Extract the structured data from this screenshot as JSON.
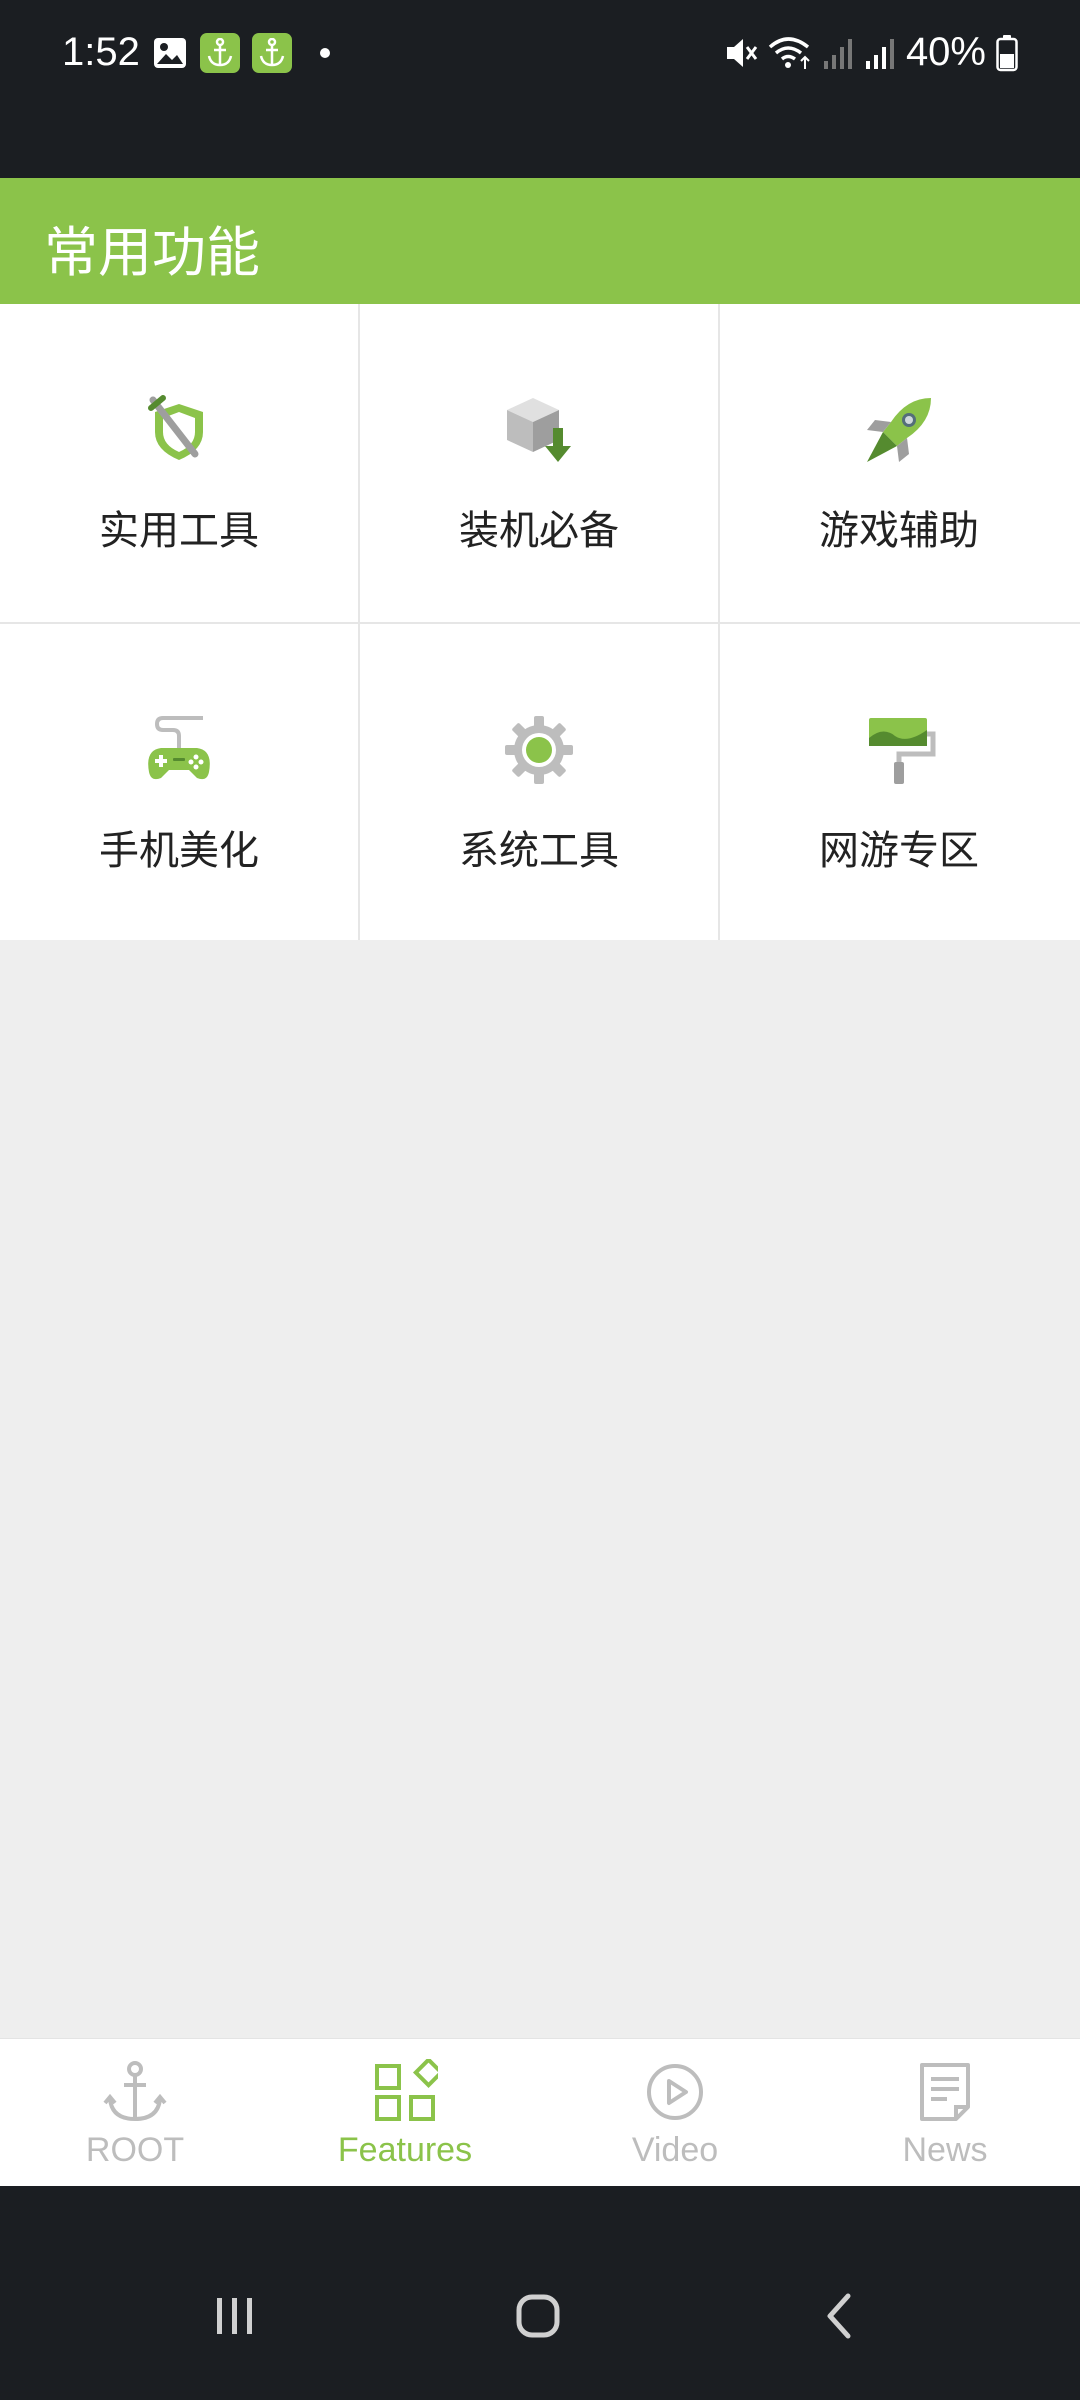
{
  "status_bar": {
    "time": "1:52",
    "battery": "40%",
    "icons": [
      "gallery-icon",
      "anchor-icon",
      "anchor-icon",
      "dot-icon",
      "mute-icon",
      "wifi-icon",
      "signal-icon",
      "signal-icon",
      "battery-icon"
    ]
  },
  "header": {
    "title": "常用功能"
  },
  "grid": {
    "items": [
      {
        "label": "实用工具",
        "icon": "shield-sword-icon"
      },
      {
        "label": "装机必备",
        "icon": "box-download-icon"
      },
      {
        "label": "游戏辅助",
        "icon": "rocket-icon"
      },
      {
        "label": "手机美化",
        "icon": "gamepad-icon"
      },
      {
        "label": "系统工具",
        "icon": "gear-icon"
      },
      {
        "label": "网游专区",
        "icon": "paint-roller-icon"
      }
    ]
  },
  "bottom_nav": {
    "items": [
      {
        "label": "ROOT",
        "icon": "anchor-icon",
        "active": false
      },
      {
        "label": "Features",
        "icon": "grid-shapes-icon",
        "active": true
      },
      {
        "label": "Video",
        "icon": "play-circle-icon",
        "active": false
      },
      {
        "label": "News",
        "icon": "document-icon",
        "active": false
      }
    ]
  },
  "colors": {
    "accent": "#8bc34a",
    "dark_bar": "#1b1e22",
    "background": "#eeeeee",
    "inactive": "#bdbdbd"
  }
}
